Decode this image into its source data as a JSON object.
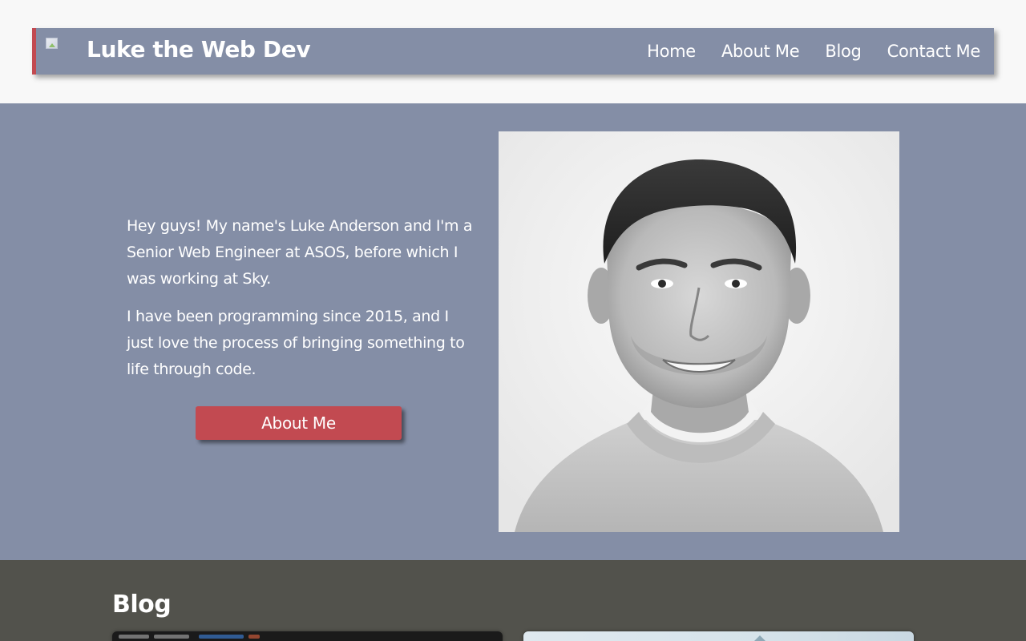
{
  "header": {
    "site_title": "Luke the Web Dev",
    "logo_alt": "logo",
    "nav": [
      {
        "label": "Home"
      },
      {
        "label": "About Me"
      },
      {
        "label": "Blog"
      },
      {
        "label": "Contact Me"
      }
    ]
  },
  "hero": {
    "intro_paragraph_1": "Hey guys! My name's Luke Anderson and I'm a Senior Web Engineer at ASOS, before which I was working at Sky.",
    "intro_paragraph_2": "I have been programming since 2015, and I just love the process of bringing something to life through code.",
    "about_button_label": "About Me",
    "portrait_alt": "Portrait of Luke Anderson"
  },
  "blog": {
    "heading": "Blog"
  },
  "colors": {
    "page_background": "#f8f8f8",
    "nav_background": "#848ea6",
    "accent": "#c24a51",
    "blog_background": "#52524c",
    "text_light": "#ffffff"
  },
  "icons": [
    "broken-image-logo-icon"
  ]
}
